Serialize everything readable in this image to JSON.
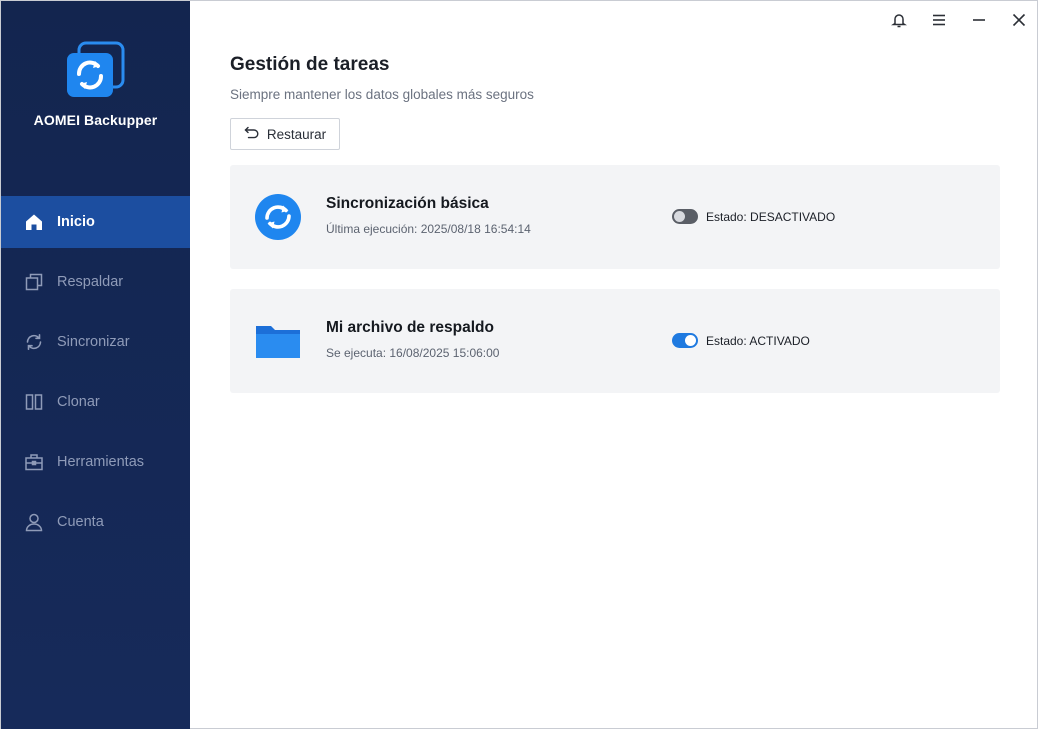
{
  "app": {
    "name": "AOMEI Backupper"
  },
  "sidebar": {
    "items": [
      {
        "label": "Inicio",
        "icon": "home-icon",
        "active": true
      },
      {
        "label": "Respaldar",
        "icon": "backup-icon",
        "active": false
      },
      {
        "label": "Sincronizar",
        "icon": "sync-icon",
        "active": false
      },
      {
        "label": "Clonar",
        "icon": "clone-icon",
        "active": false
      },
      {
        "label": "Herramientas",
        "icon": "toolbox-icon",
        "active": false
      },
      {
        "label": "Cuenta",
        "icon": "user-icon",
        "active": false
      }
    ]
  },
  "titlebar": {
    "buttons": [
      "bell-icon",
      "menu-icon",
      "minimize-icon",
      "close-icon"
    ]
  },
  "main": {
    "title": "Gestión de tareas",
    "subtitle": "Siempre mantener los datos globales más seguros",
    "restore_label": "Restaurar",
    "tasks": [
      {
        "name": "Sincronización básica",
        "meta": "Última ejecución: 2025/08/18 16:54:14",
        "status": "Estado: DESACTIVADO",
        "enabled": false,
        "icon": "sync-circle-icon"
      },
      {
        "name": "Mi archivo de respaldo",
        "meta": "Se ejecuta: 16/08/2025 15:06:00",
        "status": "Estado: ACTIVADO",
        "enabled": true,
        "icon": "folder-icon"
      }
    ]
  },
  "colors": {
    "sidebar_bg": "#13254f",
    "active_nav": "#1c4ea0",
    "accent": "#1f7ae0",
    "card_bg": "#f3f4f6"
  }
}
